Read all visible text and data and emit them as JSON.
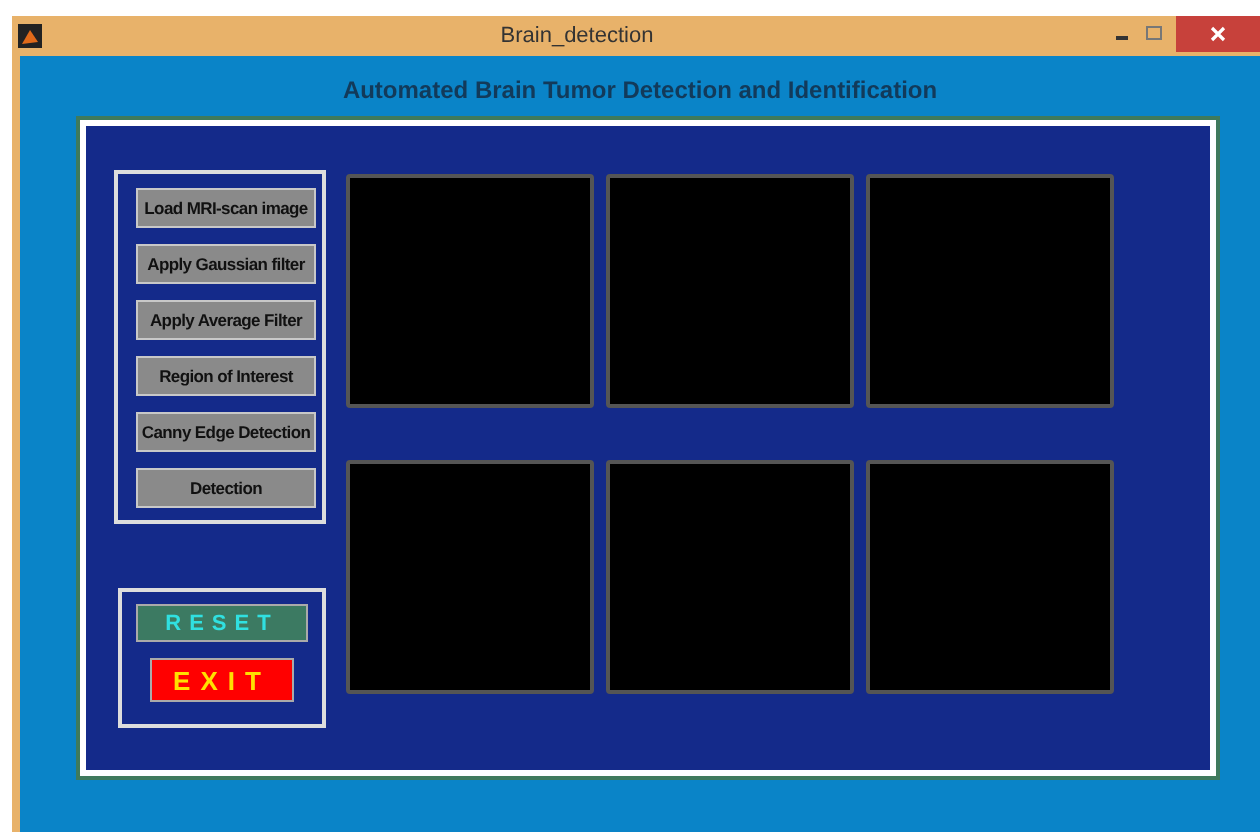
{
  "window": {
    "title": "Brain_detection"
  },
  "heading": "Automated Brain Tumor Detection and Identification",
  "buttons": [
    {
      "label": "Load MRI-scan image"
    },
    {
      "label": "Apply Gaussian filter"
    },
    {
      "label": "Apply Average Filter"
    },
    {
      "label": "Region of Interest"
    },
    {
      "label": "Canny Edge Detection"
    },
    {
      "label": "Detection"
    }
  ],
  "reset": {
    "label": "RESET"
  },
  "exit": {
    "label": "EXIT"
  },
  "axes": [
    {
      "kind": "blank"
    },
    {
      "kind": "blank"
    },
    {
      "kind": "blank"
    },
    {
      "kind": "blank"
    },
    {
      "kind": "blank"
    },
    {
      "kind": "blank"
    }
  ]
}
